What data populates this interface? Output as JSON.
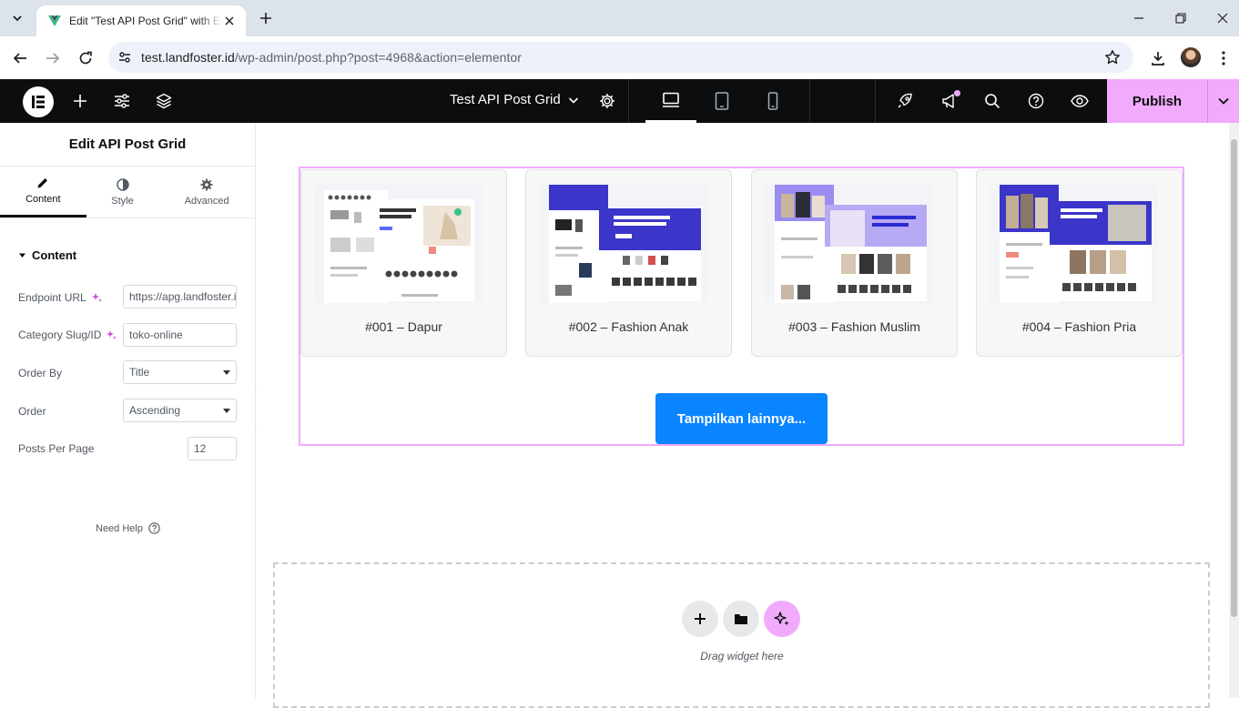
{
  "browser": {
    "tab_title": "Edit \"Test API Post Grid\" with Elementor",
    "url_host": "test.landfoster.id",
    "url_path": "/wp-admin/post.php?post=4968&action=elementor"
  },
  "topbar": {
    "doc_title": "Test API Post Grid",
    "publish_label": "Publish"
  },
  "panel": {
    "title": "Edit API Post Grid",
    "tabs": [
      {
        "label": "Content"
      },
      {
        "label": "Style"
      },
      {
        "label": "Advanced"
      }
    ],
    "section_title": "Content",
    "fields": {
      "endpoint_label": "Endpoint URL",
      "endpoint_value": "https://apg.landfoster.id",
      "category_label": "Category Slug/ID",
      "category_value": "toko-online",
      "orderby_label": "Order By",
      "orderby_value": "Title",
      "order_label": "Order",
      "order_value": "Ascending",
      "ppp_label": "Posts Per Page",
      "ppp_value": "12"
    },
    "need_help": "Need Help"
  },
  "grid": {
    "cards": [
      {
        "title": "#001 – Dapur"
      },
      {
        "title": "#002 – Fashion Anak"
      },
      {
        "title": "#003 – Fashion Muslim"
      },
      {
        "title": "#004 – Fashion Pria"
      }
    ],
    "load_more_label": "Tampilkan lainnya..."
  },
  "dropzone": {
    "text": "Drag widget here"
  },
  "colors": {
    "accent": "#f0abfc",
    "button_blue": "#0a84ff",
    "topbar_bg": "#0c0d0e"
  }
}
